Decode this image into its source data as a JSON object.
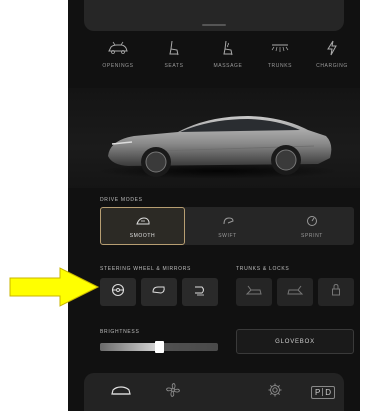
{
  "features": [
    {
      "label": "OPENINGS",
      "icon": "car-openings-icon"
    },
    {
      "label": "SEATS",
      "icon": "seat-icon"
    },
    {
      "label": "MASSAGE",
      "icon": "massage-seat-icon"
    },
    {
      "label": "TRUNKS",
      "icon": "trunk-light-icon"
    },
    {
      "label": "CHARGING",
      "icon": "lightning-icon"
    }
  ],
  "drive_modes": {
    "title": "DRIVE MODES",
    "selected": "SMOOTH",
    "items": [
      {
        "label": "SMOOTH",
        "icon": "smooth-mode-icon"
      },
      {
        "label": "SWIFT",
        "icon": "swift-mode-icon"
      },
      {
        "label": "SPRINT",
        "icon": "sprint-mode-icon"
      }
    ]
  },
  "steering": {
    "title": "STEERING WHEEL & MIRRORS",
    "items": [
      "steering-wheel-icon",
      "mirror-icon",
      "mirror-fold-icon"
    ]
  },
  "trunks_locks": {
    "title": "TRUNKS & LOCKS",
    "items": [
      "front-trunk-icon",
      "rear-trunk-icon",
      "door-lock-icon"
    ]
  },
  "brightness": {
    "title": "BRIGHTNESS",
    "level": 0.5
  },
  "glovebox": {
    "label": "GLOVEBOX"
  },
  "bottom_nav": {
    "items": [
      "car-icon",
      "fan-icon",
      "settings-gear-icon"
    ],
    "gear": {
      "p": "P",
      "d": "D"
    }
  },
  "colors": {
    "accent": "#b79e72",
    "arrow": "#ffff00",
    "panel": "#111111"
  }
}
